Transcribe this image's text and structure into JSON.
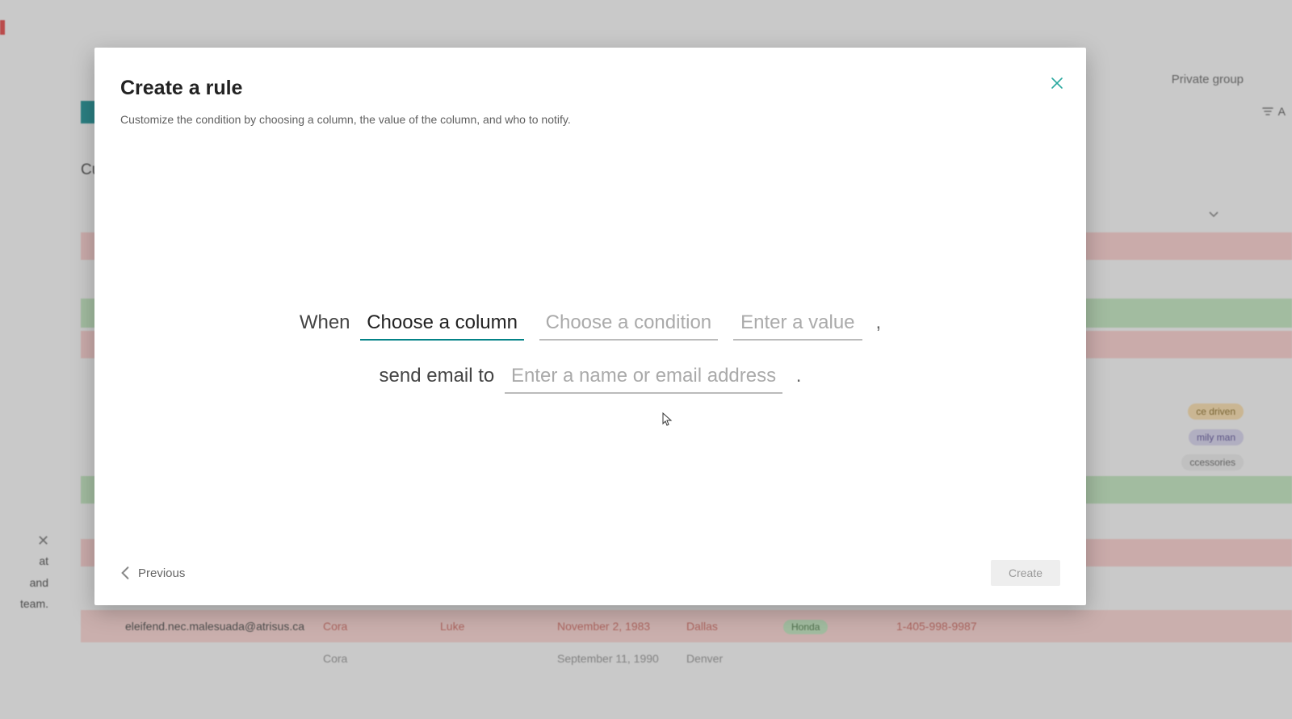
{
  "background": {
    "private_group": "Private group",
    "heading_fragment": "Cu",
    "all_filter": "A",
    "left_panel": {
      "line1": "at",
      "line2": "and",
      "line3": "team."
    },
    "pills": {
      "p1": "ce driven",
      "p2": "mily man",
      "p3": "ccessories"
    },
    "row1": {
      "email": "eleifend.nec.malesuada@atrisus.ca",
      "first": "Cora",
      "last": "Luke",
      "date": "November 2, 1983",
      "city": "Dallas",
      "brand": "Honda",
      "phone": "1-405-998-9987"
    },
    "row2_date": "September 11, 1990",
    "row2_city": "Denver",
    "row2_first": "Cora"
  },
  "dialog": {
    "title": "Create a rule",
    "subtitle": "Customize the condition by choosing a column, the value of the column, and who to notify.",
    "when_label": "When",
    "column_placeholder": "Choose a column",
    "condition_placeholder": "Choose a condition",
    "value_placeholder": "Enter a value",
    "send_label": "send email to",
    "recipient_placeholder": "Enter a name or email address",
    "comma": ",",
    "period": ".",
    "previous_label": "Previous",
    "create_label": "Create"
  }
}
